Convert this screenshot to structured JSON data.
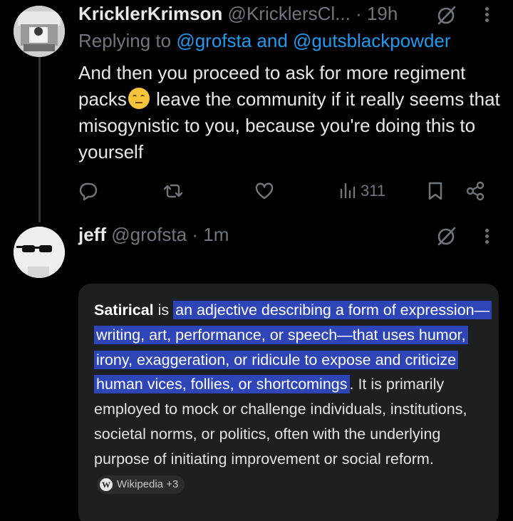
{
  "post1": {
    "display_name": "KricklerKrimson",
    "handle": "@KricklersCl...",
    "time": " · 19h",
    "replying_prefix": "Replying to ",
    "mention1": "@grofsta",
    "mention_join": " and ",
    "mention2": "@gutsblackpowder",
    "text_before_emoji": "And then you proceed to ask for more regiment packs",
    "text_after_emoji": " leave the community if it really seems that misogynistic to you, because you're doing this to yourself",
    "emoji": "relieved-face-emoji",
    "actions": {
      "views_count": "311"
    }
  },
  "post2": {
    "display_name": "jeff",
    "handle": "@grofsta",
    "time": " · 1m",
    "card": {
      "term": "Satirical",
      "is_word": " is ",
      "highlighted": "an adjective describing a form of expression—writing, art, performance, or speech—that uses humor, irony, exaggeration, or ridicule to expose and criticize human vices, follies, or shortcomings",
      "rest": ". It is primarily employed to mock or challenge individuals, institutions, societal norms, or politics, often with the underlying purpose of initiating improvement or social reform.",
      "source_icon": "W",
      "source_label": "Wikipedia +3"
    }
  },
  "colors": {
    "background": "#000000",
    "text": "#e7e9ea",
    "muted": "#71767b",
    "mention": "#1d9bf0",
    "card_bg": "#1e1f20",
    "highlight": "#2e45b8"
  }
}
